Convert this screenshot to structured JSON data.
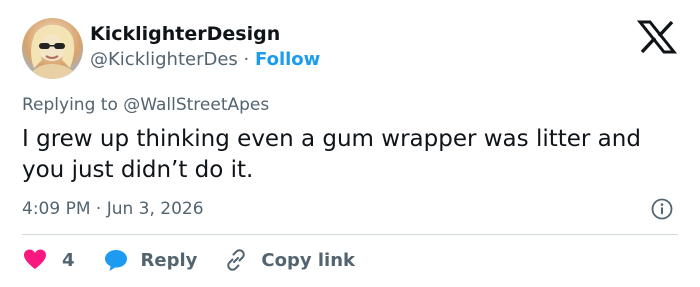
{
  "author": {
    "display_name": "KicklighterDesign",
    "handle": "@KicklighterDes",
    "separator": "·",
    "follow_label": "Follow"
  },
  "reply_context": {
    "prefix": "Replying to ",
    "mention": "@WallStreetApes"
  },
  "tweet": {
    "text": "I grew up thinking even a gum wrapper was litter and you just didn’t do it.",
    "timestamp": "4:09 PM · Jun 3, 2026"
  },
  "actions": {
    "likes_count": "4",
    "reply_label": "Reply",
    "copy_link_label": "Copy link"
  },
  "icons": {
    "logo": "x-logo-icon",
    "info": "info-icon",
    "like": "heart-icon",
    "reply": "speech-bubble-icon",
    "copy": "link-icon"
  },
  "colors": {
    "accent": "#1d9bf0",
    "like": "#f91880",
    "secondary_text": "#536471",
    "primary_text": "#0f1419"
  }
}
